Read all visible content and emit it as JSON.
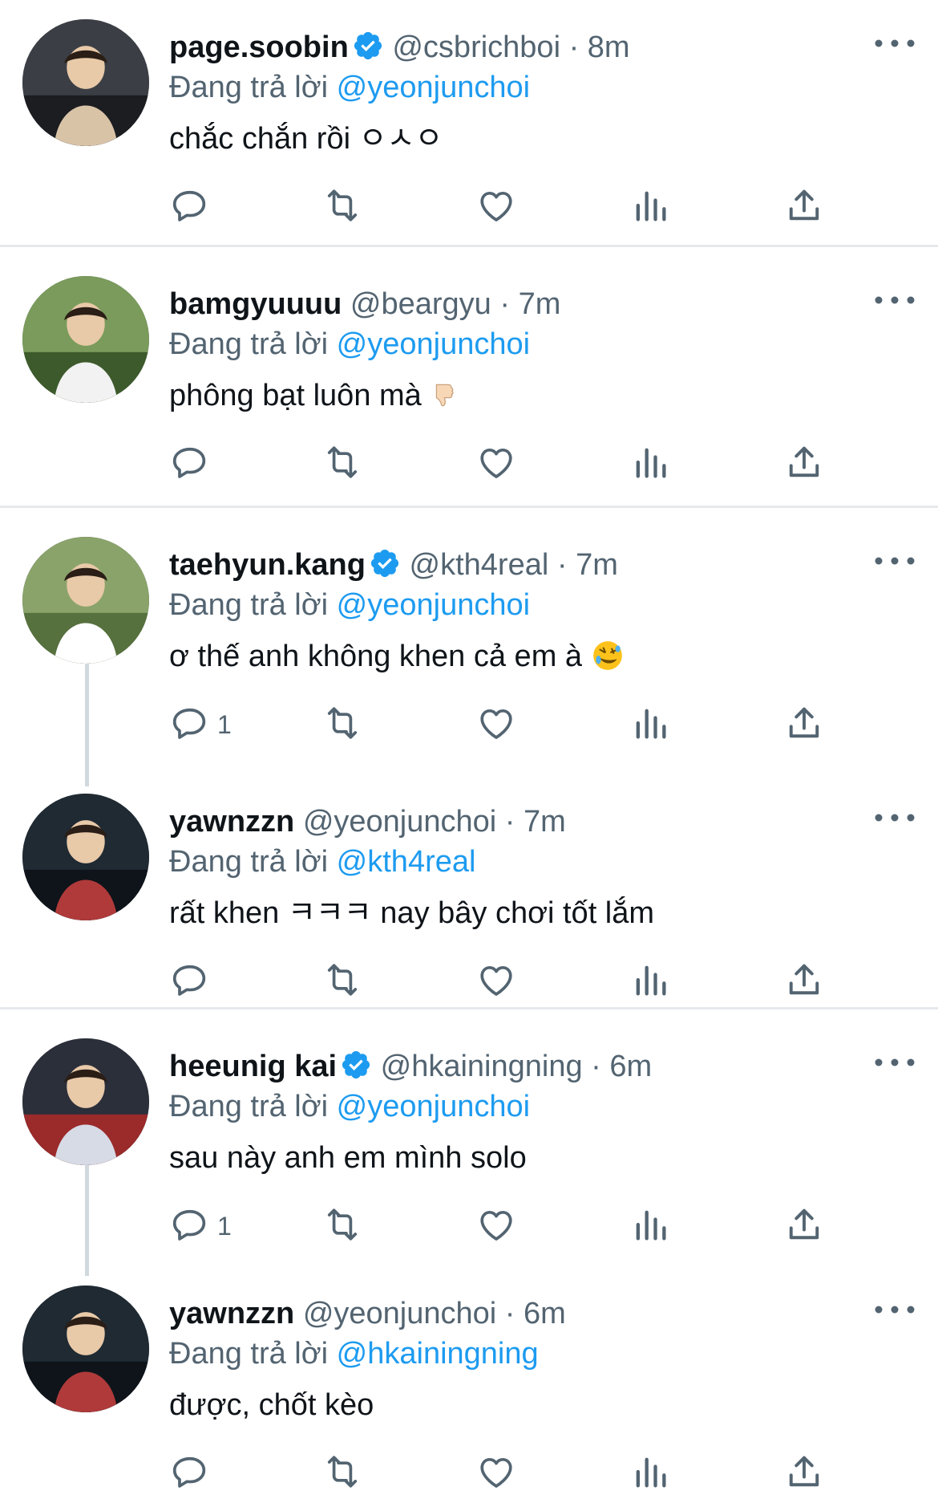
{
  "reply_prefix": "Đang trả lời",
  "separator": "·",
  "colors": {
    "accent": "#1d9bf0",
    "muted": "#536471",
    "text": "#0f1419",
    "divider": "#e6e9ec"
  },
  "tweets": [
    {
      "name": "page.soobin",
      "verified": true,
      "handle": "@csbrichboi",
      "time": "8m",
      "reply_to": "@yeonjunchoi",
      "text": "chắc chắn rồi ㅇㅅㅇ",
      "emoji": "",
      "reply_count": ""
    },
    {
      "name": "bamgyuuuu",
      "verified": false,
      "handle": "@beargyu",
      "time": "7m",
      "reply_to": "@yeonjunchoi",
      "text": "phông bạt luôn mà",
      "emoji": "thumbs-down",
      "reply_count": ""
    },
    {
      "name": "taehyun.kang",
      "verified": true,
      "handle": "@kth4real",
      "time": "7m",
      "reply_to": "@yeonjunchoi",
      "text": "ơ thế anh không khen cả em à",
      "emoji": "rofl",
      "reply_count": "1"
    },
    {
      "name": "yawnzzn",
      "verified": false,
      "handle": "@yeonjunchoi",
      "time": "7m",
      "reply_to": "@kth4real",
      "text": "rất khen ㅋㅋㅋ nay bây chơi tốt lắm",
      "emoji": "",
      "reply_count": ""
    },
    {
      "name": "heeunig kai",
      "verified": true,
      "handle": "@hkainingning",
      "time": "6m",
      "reply_to": "@yeonjunchoi",
      "text": "sau này anh em mình solo",
      "emoji": "",
      "reply_count": "1"
    },
    {
      "name": "yawnzzn",
      "verified": false,
      "handle": "@yeonjunchoi",
      "time": "6m",
      "reply_to": "@hkainingning",
      "text": "được, chốt kèo",
      "emoji": "",
      "reply_count": ""
    }
  ]
}
